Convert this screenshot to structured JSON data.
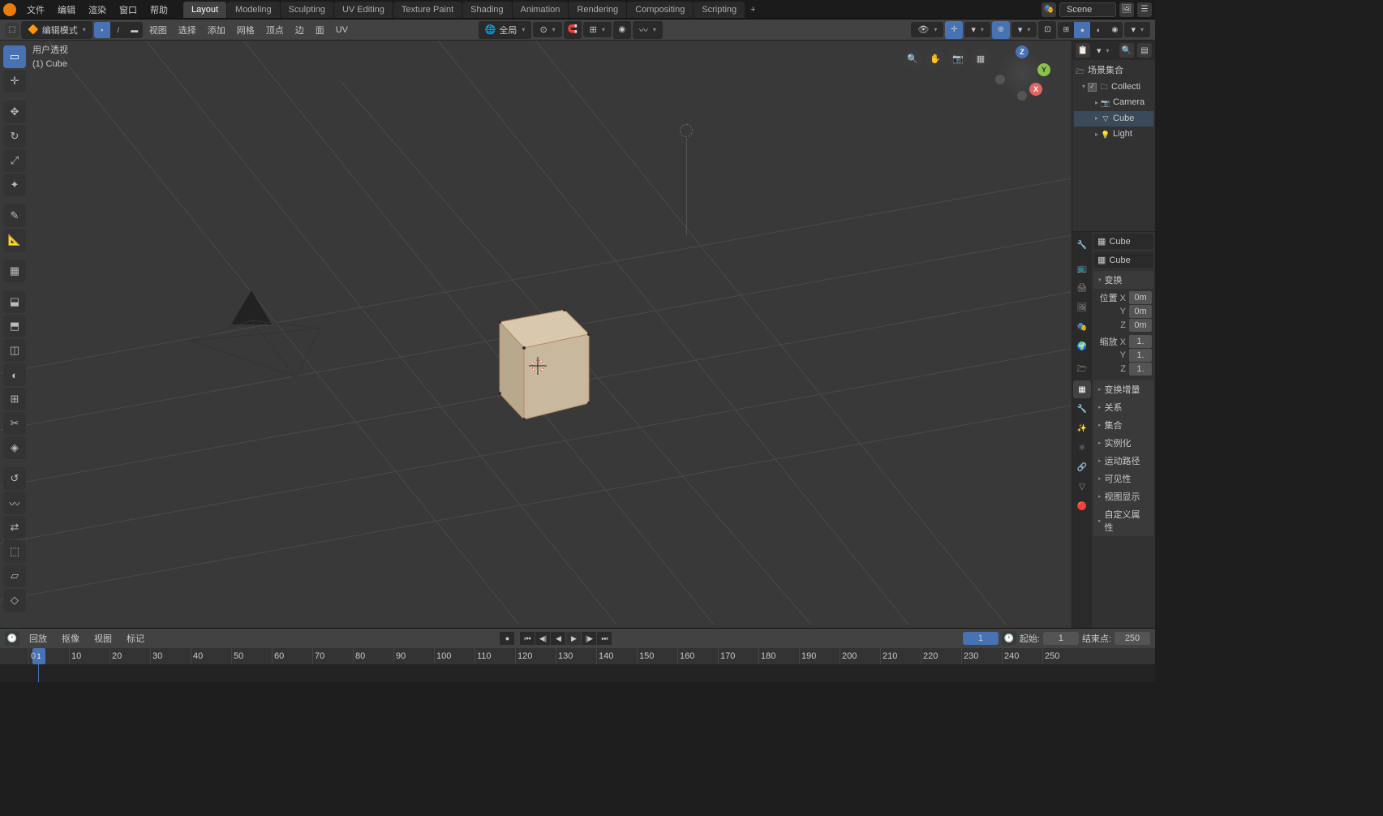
{
  "topmenu": [
    "文件",
    "编辑",
    "渲染",
    "窗口",
    "帮助"
  ],
  "tabs": [
    "Layout",
    "Modeling",
    "Sculpting",
    "UV Editing",
    "Texture Paint",
    "Shading",
    "Animation",
    "Rendering",
    "Compositing",
    "Scripting"
  ],
  "scene_label": "Scene",
  "mode": "编辑模式",
  "header_menus": [
    "视图",
    "选择",
    "添加",
    "网格",
    "顶点",
    "边",
    "面",
    "UV"
  ],
  "global": "全局",
  "vp_info": {
    "line1": "用户透视",
    "line2": "(1) Cube"
  },
  "outliner": {
    "title": "场景集合",
    "root": "Collecti",
    "items": [
      "Camera",
      "Cube",
      "Light"
    ]
  },
  "props": {
    "obj": "Cube",
    "transform": "变换",
    "pos": "位置",
    "scale": "缩放",
    "posv": {
      "x": "0m",
      "y": "0m",
      "z": "0m"
    },
    "scalev": {
      "x": "1.",
      "y": "1.",
      "z": "1."
    },
    "sections": [
      "变换增量",
      "关系",
      "集合",
      "实例化",
      "运动路径",
      "可见性",
      "视图显示",
      "自定义属性"
    ]
  },
  "timeline": {
    "menus": [
      "回放",
      "抠像",
      "视图",
      "标记"
    ],
    "current": "1",
    "start_lbl": "起始:",
    "start": "1",
    "end_lbl": "结束点:",
    "end": "250",
    "ticks": [
      0,
      10,
      20,
      30,
      40,
      50,
      60,
      70,
      80,
      90,
      100,
      110,
      120,
      130,
      140,
      150,
      160,
      170,
      180,
      190,
      200,
      210,
      220,
      230,
      240,
      250
    ]
  }
}
